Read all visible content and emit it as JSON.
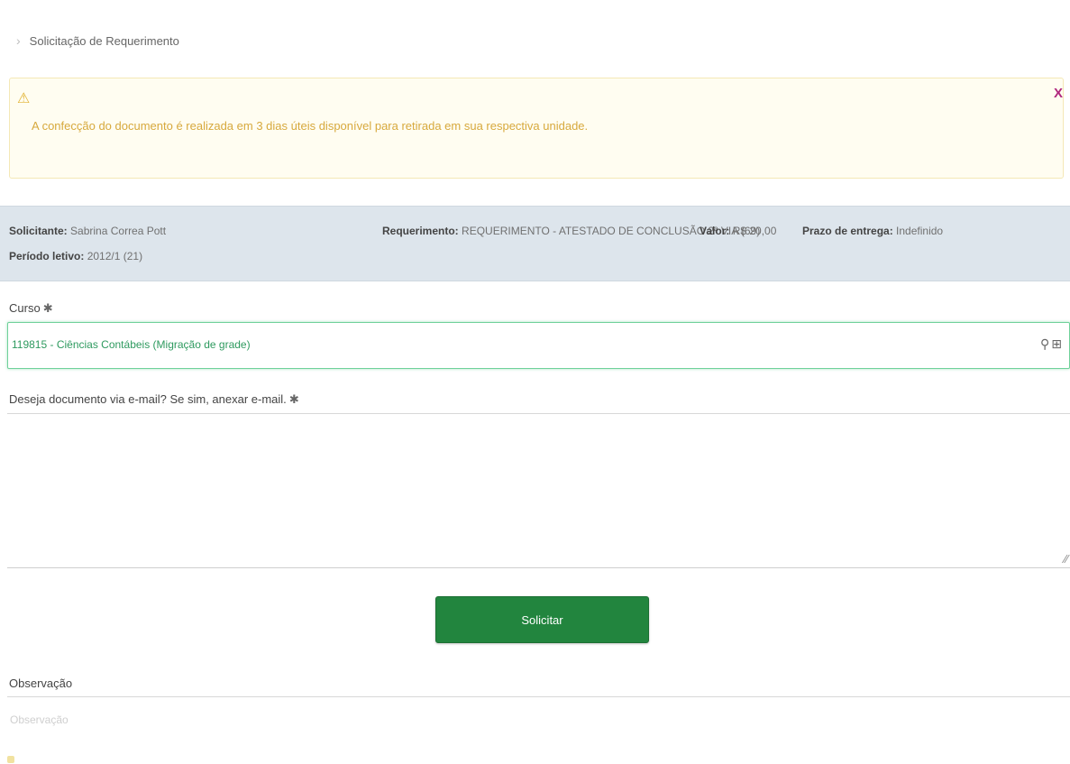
{
  "breadcrumb": {
    "chevron": "›",
    "label": "Solicitação de Requerimento"
  },
  "alert": {
    "icon": "⚠",
    "message": "A confecção do documento é realizada em 3 dias úteis disponível para retirada em sua respectiva unidade.",
    "close": "X"
  },
  "info": {
    "solicitante_label": "Solicitante:",
    "solicitante_value": "Sabrina Correa Pott",
    "periodo_label": "Período letivo:",
    "periodo_value": "2012/1 (21)",
    "requerimento_label": "Requerimento:",
    "requerimento_value": "REQUERIMENTO - ATESTADO DE CONCLUSÃO 2ª VIA (69)",
    "valor_label": "Valor:",
    "valor_value": "R$ 20,00",
    "prazo_label": "Prazo de entrega:",
    "prazo_value": "Indefinido"
  },
  "curso": {
    "label": "Curso",
    "required": "✱",
    "value": "119815 - Ciências Contábeis (Migração de grade)",
    "search_icon": "search-icon",
    "expand_icon": "expand-icon",
    "icons_text": "🔍︎ ⊞"
  },
  "email_field": {
    "label": "Deseja documento via e-mail? Se sim, anexar e-mail.",
    "required": "✱",
    "value": "",
    "grip": "⁄⁄"
  },
  "submit": {
    "label": "Solicitar"
  },
  "observacao": {
    "label": "Observação",
    "placeholder": "Observação"
  },
  "colors": {
    "alert_bg": "#fffdf1",
    "alert_text": "#d7a93d",
    "close": "#b0277d",
    "infobar_bg": "#dde5ec",
    "select_border": "#6fd19a",
    "select_text": "#2e9a5f",
    "button_bg": "#22853e"
  }
}
